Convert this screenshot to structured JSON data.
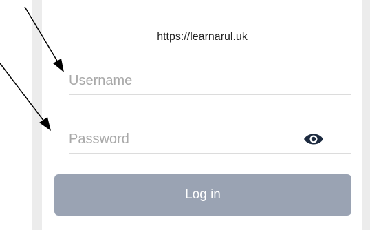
{
  "site": {
    "url": "https://learnarul.uk"
  },
  "login_form": {
    "username_placeholder": "Username",
    "username_value": "",
    "password_placeholder": "Password",
    "password_value": "",
    "password_toggle_icon": "eye-icon",
    "submit_label": "Log in"
  },
  "annotations": {
    "arrow_icon": "arrow-pointer-icon",
    "arrow_color": "#000000"
  },
  "colors": {
    "button_background": "#9aa3b3",
    "button_text": "#ffffff",
    "eye_icon": "#1c2a3f",
    "placeholder": "#a9a9a9",
    "gutter": "#ececec"
  }
}
